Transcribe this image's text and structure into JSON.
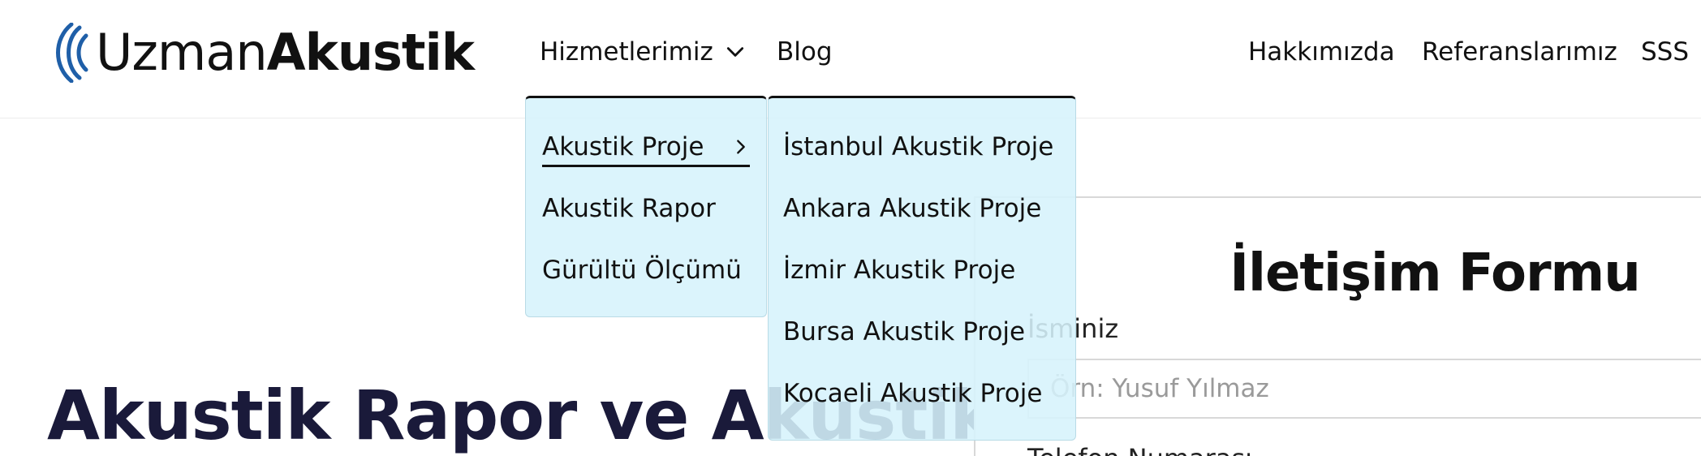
{
  "header": {
    "logo": {
      "part1": "Uzman",
      "part2": "Akustik",
      "icon": "sound-waves-icon"
    },
    "nav": {
      "services": "Hizmetlerimiz",
      "blog": "Blog",
      "about": "Hakkımızda",
      "references": "Referanslarımız",
      "faq": "SSS"
    }
  },
  "dropdown": {
    "services": {
      "items": [
        "Akustik Proje",
        "Akustik Rapor",
        "Gürültü Ölçümü"
      ],
      "active_index": 0
    },
    "akustik_proje": {
      "items": [
        "İstanbul Akustik Proje",
        "Ankara Akustik Proje",
        "İzmir Akustik Proje",
        "Bursa Akustik Proje",
        "Kocaeli Akustik Proje"
      ]
    }
  },
  "hero": {
    "title": "Akustik Rapor ve Akustik"
  },
  "contact_form": {
    "title": "İletişim Formu",
    "name_label": "İsminiz",
    "name_placeholder": "Örn: Yusuf Yılmaz",
    "phone_label": "Telefon Numarası"
  },
  "colors": {
    "accent_blue": "#1f5fa8",
    "dropdown_bg": "#d6f3fc",
    "hero_text": "#1a1a3a"
  }
}
